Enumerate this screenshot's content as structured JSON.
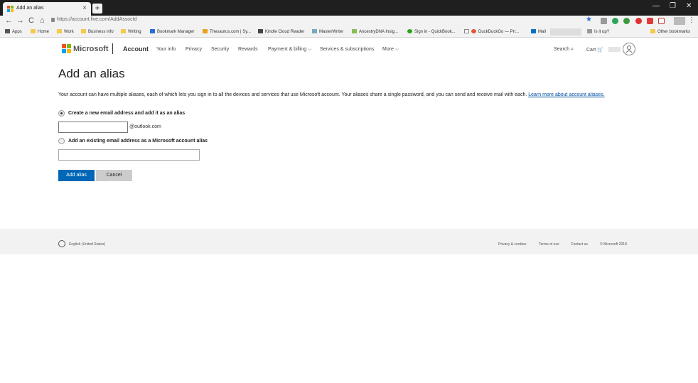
{
  "browser": {
    "tab_title": "Add an alias",
    "tab_close": "×",
    "new_tab": "+",
    "window_controls": [
      "—",
      "❐",
      "✕"
    ],
    "nav": [
      "←",
      "→",
      "C",
      "⌂"
    ],
    "url": "https://account.live.com/AddAssocId",
    "bookmarks": [
      "Apps",
      "Home",
      "Work",
      "Business info",
      "Writing",
      "Bookmark Manager",
      "Thesaurus.com | Sy...",
      "Kindle Cloud Reader",
      "MasterWriter",
      "AncestryDNA Insig...",
      "Sign in - QuickBook...",
      "DuckDuckGo — Pri...",
      "Mail",
      "Is it up?",
      "Other bookmarks"
    ]
  },
  "header": {
    "brand": "Microsoft",
    "account": "Account",
    "nav": [
      "Your info",
      "Privacy",
      "Security",
      "Rewards",
      "Payment & billing ⌵",
      "Services & subscriptions",
      "More ⌵"
    ],
    "search": "Search ⌕",
    "cart": "Cart 🛒"
  },
  "main": {
    "title": "Add an alias",
    "description": "Your account can have multiple aliases, each of which lets you sign in to all the devices and services that use Microsoft account. Your aliases share a single password, and you can send and receive mail with each. ",
    "learn_more": "Learn more about account aliases.",
    "option_new": "Create a new email address and add it as an alias",
    "domain_suffix": "@outlook.com",
    "option_existing": "Add an existing email address as a Microsoft account alias",
    "new_value": "",
    "existing_value": "",
    "add_button": "Add alias",
    "cancel_button": "Cancel"
  },
  "footer": {
    "language": "English (United States)",
    "links": [
      "Privacy & cookies",
      "Terms of use",
      "Contact us",
      "© Microsoft 2018"
    ]
  },
  "colors": {
    "accent": "#0067b8",
    "link": "#0050a5",
    "footer_bg": "#f2f2f2"
  }
}
